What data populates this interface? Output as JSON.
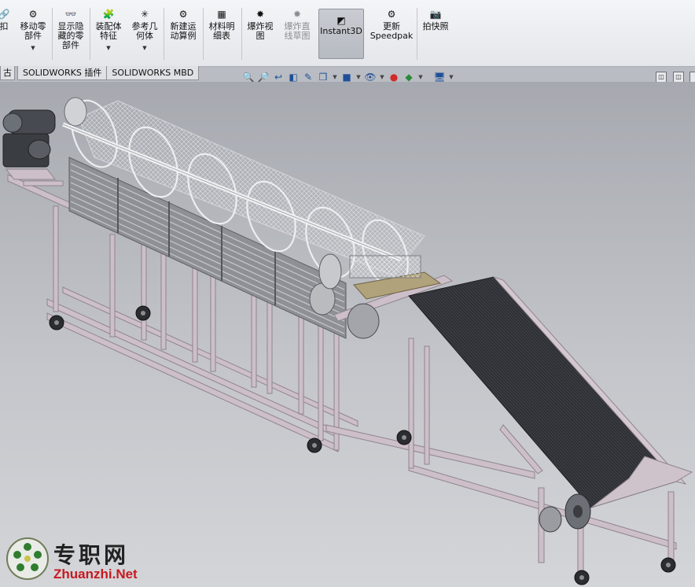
{
  "ribbon": {
    "items": [
      {
        "label": "扣\n",
        "icon": "mate-icon"
      },
      {
        "label": "移动零\n部件",
        "icon": "move-component-icon",
        "dropdown": true
      },
      {
        "label": "显示隐\n藏的零\n部件",
        "icon": "show-hidden-icon"
      },
      {
        "label": "装配体\n特征",
        "icon": "assembly-feature-icon",
        "dropdown": true
      },
      {
        "label": "参考几\n何体",
        "icon": "reference-geometry-icon",
        "dropdown": true
      },
      {
        "label": "新建运\n动算例",
        "icon": "motion-study-icon"
      },
      {
        "label": "材料明\n细表",
        "icon": "bom-icon"
      },
      {
        "label": "爆炸视\n图",
        "icon": "exploded-view-icon"
      },
      {
        "label": "爆炸直\n线草图",
        "icon": "explode-line-sketch-icon",
        "disabled": true
      },
      {
        "label": "Instant3D",
        "icon": "instant3d-icon",
        "active": true
      },
      {
        "label": "更新\nSpeedpak",
        "icon": "speedpak-icon"
      },
      {
        "label": "拍快照",
        "icon": "snapshot-icon"
      }
    ]
  },
  "tabs": [
    "古",
    "SOLIDWORKS 插件",
    "SOLIDWORKS MBD"
  ],
  "hud_icons": [
    "zoom-to-fit-icon",
    "zoom-to-area-icon",
    "previous-view-icon",
    "section-view-icon",
    "dynamic-annotation-icon",
    "view-orientation-icon",
    "display-style-icon",
    "hide-show-items-icon",
    "edit-appearance-icon",
    "apply-scene-icon",
    "view-settings-icon"
  ],
  "watermark": {
    "cn": "专职网",
    "en": "Zhuanzhi.Net"
  },
  "colors": {
    "belt": "#2f3136",
    "frame": "#c9bcc6",
    "mesh": "#e8eaee",
    "motor": "#3a3d42"
  }
}
